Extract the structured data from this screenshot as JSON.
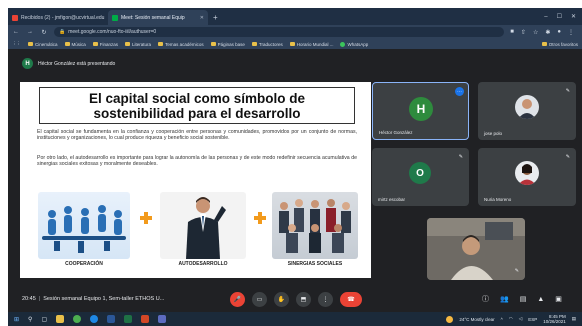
{
  "browser": {
    "tabs": [
      {
        "label": "Recibidos (2) - jmfigon@ucvirtual.edu",
        "active": false,
        "icon": "gmail-icon",
        "color": "#ea4335"
      },
      {
        "label": "Meet: Sesión semanal Equip",
        "active": true,
        "icon": "meet-icon",
        "color": "#00ac47"
      }
    ],
    "url": "meet.google.com/nuo-fto-iiil/authuser=0",
    "bookmarks": [
      {
        "label": "Cinemática",
        "type": "folder"
      },
      {
        "label": "Música",
        "type": "folder"
      },
      {
        "label": "Finanzas",
        "type": "folder"
      },
      {
        "label": "Literatura",
        "type": "folder"
      },
      {
        "label": "Temas académicos",
        "type": "folder"
      },
      {
        "label": "Páginas base",
        "type": "folder"
      },
      {
        "label": "Traductores",
        "type": "folder"
      },
      {
        "label": "Horario Mundial ...",
        "type": "folder"
      },
      {
        "label": "WhatsApp",
        "type": "whatsapp"
      }
    ],
    "other_bookmarks": "Otros favoritos"
  },
  "meet": {
    "presenting_initial": "H",
    "presenting_text": "Héctor González está presentando",
    "slide": {
      "title": "El capital social como símbolo de sostenibilidad para el desarrollo",
      "paragraph1": "El capital social se fundamenta en la confianza y cooperación entre personas y comunidades, promovidos por un conjunto de normas, instituciones y organizaciones, lo cual produce riqueza y beneficio social sostenible.",
      "paragraph2": "Por otro lado, el autodesarrollo es importante para lograr la autonomía de las personas y de este modo redefinir secuencia acumulativa de sinergias sociales exitosas y moralmente deseables.",
      "labels": [
        "COOPERACIÓN",
        "AUTODESARROLLO",
        "SINERGIAS SOCIALES"
      ]
    },
    "participants": [
      {
        "name": "Héctor González",
        "initial": "H",
        "avatar_color": "#2e8b3d",
        "kind": "letter"
      },
      {
        "name": "jose polo",
        "kind": "photo"
      },
      {
        "name": "mirtz escobar",
        "initial": "O",
        "avatar_color": "#1f7a4a",
        "kind": "letter"
      },
      {
        "name": "Nuria Moreno",
        "kind": "photo"
      },
      {
        "name": "",
        "kind": "video"
      }
    ],
    "meeting_time": "20:45",
    "meeting_title": "Sesión semanal Equipo 1, Sem-taller ETHOS U...",
    "controls": {
      "mic": "mic-off-icon",
      "camera": "camera-off-icon",
      "hand": "raise-hand-icon",
      "present": "present-icon",
      "more": "more-options-icon",
      "hangup": "hang-up-icon"
    }
  },
  "taskbar": {
    "weather": "24°C  Mostly clear",
    "lang": "ESP",
    "time": "8:45 PM",
    "date": "10/26/2021"
  }
}
